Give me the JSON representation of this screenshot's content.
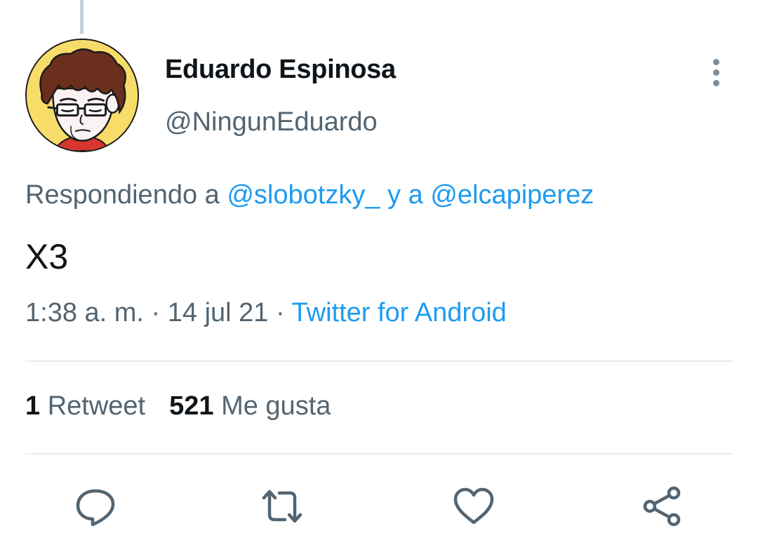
{
  "tweet": {
    "author": {
      "display_name": "Eduardo Espinosa",
      "handle": "@NingunEduardo"
    },
    "reply": {
      "prefix": "Respondiendo a",
      "mention_1": "@slobotzky_",
      "joiner": "y a",
      "mention_2": "@elcapiperez"
    },
    "text": "X3",
    "meta": {
      "time": "1:38 a. m.",
      "separator": "·",
      "date": "14 jul 21",
      "source": "Twitter for Android"
    },
    "stats": {
      "retweets_count": "1",
      "retweets_label": "Retweet",
      "likes_count": "521",
      "likes_label": "Me gusta"
    },
    "actions": [
      {
        "icon": "reply-icon"
      },
      {
        "icon": "retweet-icon"
      },
      {
        "icon": "heart-icon"
      },
      {
        "icon": "share-icon"
      }
    ]
  },
  "colors": {
    "link": "#1d9bf0",
    "secondary_text": "#536471",
    "primary_text": "#0f1419",
    "divider": "#e6ecf0",
    "avatar_background": "#f7dc6a"
  }
}
